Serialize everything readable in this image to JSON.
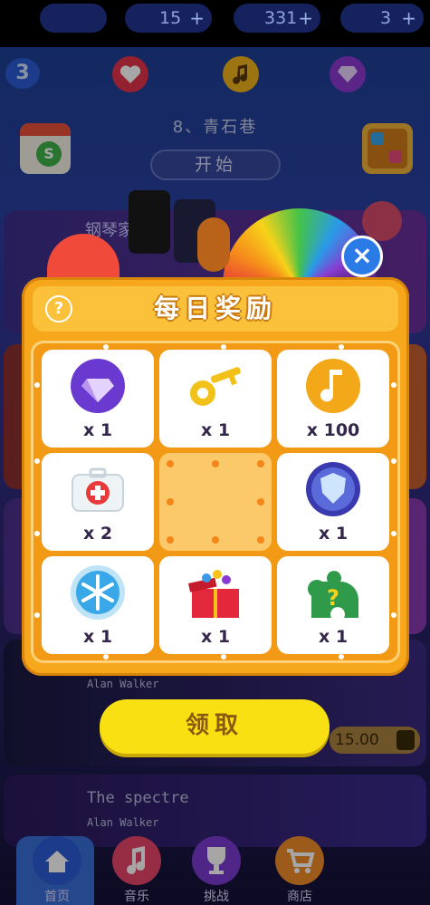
{
  "topbar": {
    "level": "3",
    "lives": "15",
    "notes": "331",
    "diamonds": "3",
    "plus": "+"
  },
  "song": {
    "title": "8、青石巷",
    "start_label": "开始"
  },
  "background_songs": [
    {
      "name": "钢琴家",
      "artist": ""
    },
    {
      "name": "",
      "artist": "Alan Walker",
      "price": "15.00"
    },
    {
      "name": "The spectre",
      "artist": "Alan Walker"
    }
  ],
  "dialog": {
    "title": "每日奖励",
    "help": "?",
    "close": "×",
    "rewards": [
      {
        "icon": "diamond-icon",
        "qty": "x 1"
      },
      {
        "icon": "key-icon",
        "qty": "x 1"
      },
      {
        "icon": "music-note-icon",
        "qty": "x 100"
      },
      {
        "icon": "first-aid-kit-icon",
        "qty": "x 2"
      },
      {
        "icon": "empty",
        "qty": ""
      },
      {
        "icon": "shield-icon",
        "qty": "x 1"
      },
      {
        "icon": "snowflake-icon",
        "qty": "x 1"
      },
      {
        "icon": "gift-box-icon",
        "qty": "x 1"
      },
      {
        "icon": "puzzle-hint-icon",
        "qty": "x 1"
      }
    ],
    "claim_label": "领取"
  },
  "nav": [
    {
      "label": "首页",
      "icon": "home-icon",
      "active": true
    },
    {
      "label": "音乐",
      "icon": "music-icon"
    },
    {
      "label": "挑战",
      "icon": "trophy-icon"
    },
    {
      "label": "商店",
      "icon": "shop-cart-icon"
    }
  ],
  "colors": {
    "dialog_orange": "#f7a71c",
    "claim_yellow": "#f8e012",
    "close_blue": "#2b7be6"
  }
}
